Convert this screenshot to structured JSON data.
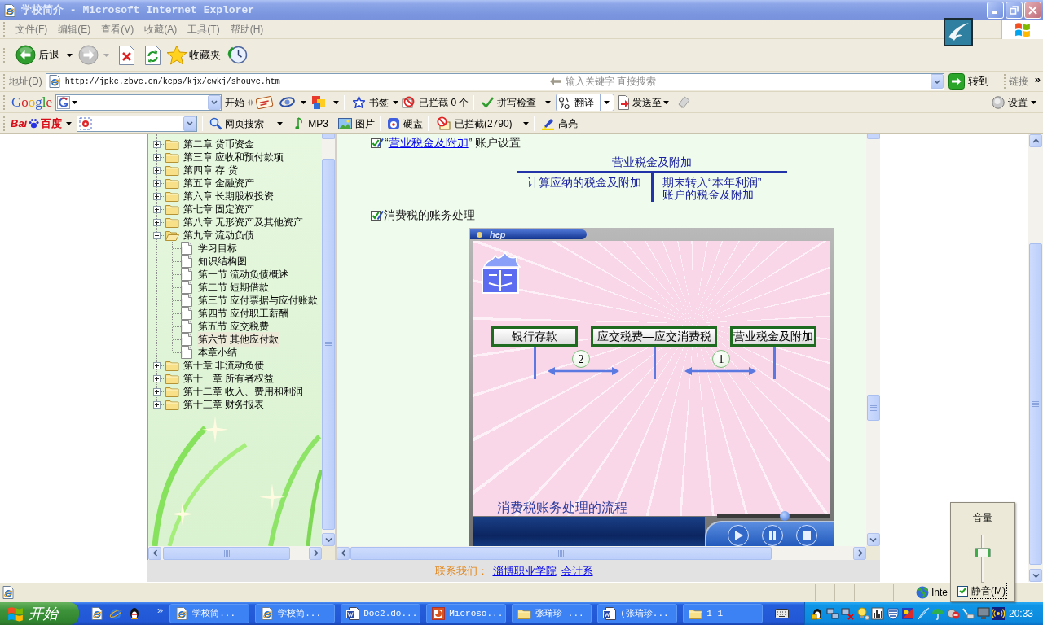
{
  "window": {
    "title": "学校简介 - Microsoft Internet Explorer"
  },
  "menu": [
    "文件(F)",
    "编辑(E)",
    "查看(V)",
    "收藏(A)",
    "工具(T)",
    "帮助(H)"
  ],
  "toolbar": {
    "back": {
      "label": "后退",
      "disabled": false
    },
    "forward": {
      "disabled": true
    },
    "favorites": "收藏夹"
  },
  "address_bar": {
    "label": "地址(D)",
    "value": "http://jpkc.zbvc.cn/kcps/kjx/cwkj/shouye.htm",
    "search_hint": "输入关键字 直接搜索",
    "go": "转到",
    "links": "链接",
    "more": "»"
  },
  "google_toolbar": {
    "logo": "Google",
    "search_button": "开始",
    "bookmarks": "书签",
    "blocked": "已拦截 0 个",
    "spellcheck": "拼写检查",
    "translate": "翻译",
    "send_to": "发送至",
    "settings": "设置"
  },
  "baidu_toolbar": {
    "logo": [
      "Bai",
      "百度"
    ],
    "web_search": "网页搜索",
    "mp3": "MP3",
    "images": "图片",
    "disk": "硬盘",
    "blocked": "已拦截(2790)",
    "highlight": "高亮"
  },
  "tree": [
    {
      "label": "第二章 货币资金",
      "expanded": false,
      "selected": false
    },
    {
      "label": "第三章 应收和预付款项",
      "expanded": false,
      "selected": false
    },
    {
      "label": "第四章 存 货",
      "expanded": false,
      "selected": false
    },
    {
      "label": "第五章 金融资产",
      "expanded": false,
      "selected": false
    },
    {
      "label": "第六章 长期股权投资",
      "expanded": false,
      "selected": false
    },
    {
      "label": "第七章 固定资产",
      "expanded": false,
      "selected": false
    },
    {
      "label": "第八章 无形资产及其他资产",
      "expanded": false,
      "selected": false
    },
    {
      "label": "第九章 流动负债",
      "expanded": true,
      "selected": false,
      "children": [
        {
          "label": "学习目标",
          "selected": false
        },
        {
          "label": "知识结构图",
          "selected": false
        },
        {
          "label": "第一节 流动负债概述",
          "selected": false
        },
        {
          "label": "第二节 短期借款",
          "selected": false
        },
        {
          "label": "第三节 应付票据与应付账款",
          "selected": false
        },
        {
          "label": "第四节 应付职工薪酬",
          "selected": false
        },
        {
          "label": "第五节 应交税费",
          "selected": false
        },
        {
          "label": "第六节 其他应付款",
          "selected": true
        },
        {
          "label": "本章小结",
          "selected": false
        }
      ]
    },
    {
      "label": "第十章 非流动负债",
      "expanded": false,
      "selected": false
    },
    {
      "label": "第十一章 所有者权益",
      "expanded": false,
      "selected": false
    },
    {
      "label": "第十二章 收入、费用和利润",
      "expanded": false,
      "selected": false
    },
    {
      "label": "第十三章 财务报表",
      "expanded": false,
      "selected": false
    }
  ],
  "content": {
    "account_heading": {
      "open": "“",
      "link": "营业税金及附加",
      "rest": "” 账户设置"
    },
    "t_account": {
      "title": "营业税金及附加",
      "left": "计算应纳的税金及附加",
      "right": [
        "期末转入“本年利润”",
        "账户的税金及附加"
      ]
    },
    "section_heading": "消费税的账务处理",
    "flash": {
      "brand": "hep",
      "accounts": [
        "银行存款",
        "应交税费—应交消费税",
        "营业税金及附加"
      ],
      "steps": [
        "2",
        "1"
      ],
      "caption": "消费税账务处理的流程",
      "seek": {
        "level": 0.6
      }
    }
  },
  "footer": {
    "contact_label": "联系我们：",
    "links": [
      "淄博职业学院",
      "会计系"
    ]
  },
  "status_bar": {
    "zone": "Inte"
  },
  "volume": {
    "title": "音量",
    "level": 0.67,
    "mute": {
      "label": "静音(M)",
      "checked": true
    }
  },
  "taskbar": {
    "start": "开始",
    "quick_launch_more": "»",
    "tasks": [
      {
        "label": "学校简...",
        "kind": "browser",
        "selected": false
      },
      {
        "label": "学校简...",
        "kind": "browser",
        "selected": false
      },
      {
        "label": "Doc2.do...",
        "kind": "document",
        "selected": false
      },
      {
        "label": "Microso...",
        "kind": "slides",
        "selected": false
      },
      {
        "label": "张瑞珍 ...",
        "kind": "folder",
        "selected": false
      },
      {
        "label": "(张瑞珍...",
        "kind": "document",
        "selected": false
      },
      {
        "label": "1-1",
        "kind": "folder",
        "selected": false
      }
    ],
    "clock": "20:33"
  }
}
